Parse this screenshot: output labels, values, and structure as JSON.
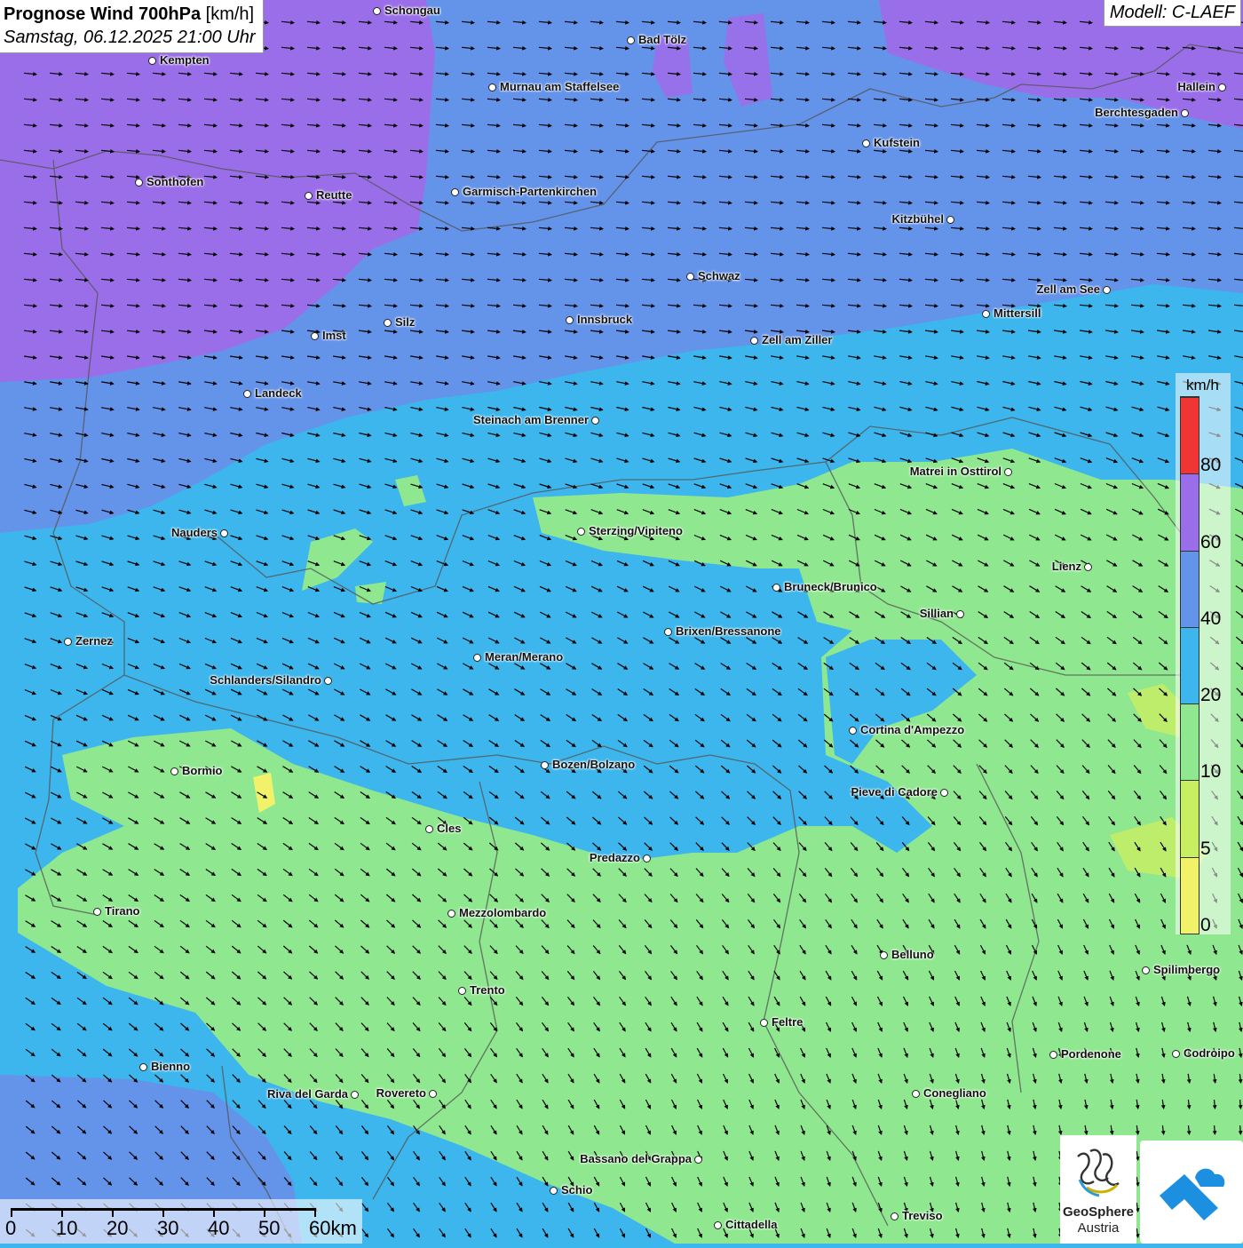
{
  "title": {
    "main": "Prognose Wind 700hPa",
    "unit": "[km/h]",
    "datetime": "Samstag, 06.12.2025 21:00 Uhr"
  },
  "model": "Modell: C-LAEF",
  "legend": {
    "unit": "km/h",
    "levels": [
      "0",
      "5",
      "10",
      "20",
      "40",
      "60",
      "80"
    ],
    "colors": [
      "#f2f26a",
      "#c8ee62",
      "#8fe88f",
      "#3cb6ec",
      "#6493ea",
      "#9b6ee9",
      "#f03535",
      "#6fc8f0"
    ]
  },
  "scalebar": {
    "labels": [
      "0",
      "10",
      "20",
      "30",
      "40",
      "50",
      "60km"
    ]
  },
  "logos": {
    "geosphere_line1": "GeoSphere",
    "geosphere_line2": "Austria"
  },
  "cities": [
    {
      "name": "Schongau"
    },
    {
      "name": "Bad Tölz"
    },
    {
      "name": "Kempten"
    },
    {
      "name": "Murnau am Staffelsee"
    },
    {
      "name": "Hallein"
    },
    {
      "name": "Berchtesgaden"
    },
    {
      "name": "Kufstein"
    },
    {
      "name": "Sonthofen"
    },
    {
      "name": "Reutte"
    },
    {
      "name": "Garmisch-Partenkirchen"
    },
    {
      "name": "Kitzbühel"
    },
    {
      "name": "Schwaz"
    },
    {
      "name": "Zell am See"
    },
    {
      "name": "Mittersill"
    },
    {
      "name": "Imst"
    },
    {
      "name": "Silz"
    },
    {
      "name": "Innsbruck"
    },
    {
      "name": "Zell am Ziller"
    },
    {
      "name": "Landeck"
    },
    {
      "name": "Steinach am Brenner"
    },
    {
      "name": "Matrei in Osttirol"
    },
    {
      "name": "Nauders"
    },
    {
      "name": "Sterzing/Vipiteno"
    },
    {
      "name": "Lienz"
    },
    {
      "name": "Bruneck/Brunico"
    },
    {
      "name": "Sillian"
    },
    {
      "name": "Zernez"
    },
    {
      "name": "Brixen/Bressanone"
    },
    {
      "name": "Meran/Merano"
    },
    {
      "name": "Schlanders/Silandro"
    },
    {
      "name": "Cortina d'Ampezzo"
    },
    {
      "name": "Bormio"
    },
    {
      "name": "Bozen/Bolzano"
    },
    {
      "name": "Pieve di Cadore"
    },
    {
      "name": "Cles"
    },
    {
      "name": "Predazzo"
    },
    {
      "name": "Tirano"
    },
    {
      "name": "Mezzolombardo"
    },
    {
      "name": "Belluno"
    },
    {
      "name": "Spilimbergo"
    },
    {
      "name": "Trento"
    },
    {
      "name": "Feltre"
    },
    {
      "name": "Pordenone"
    },
    {
      "name": "Codroipo"
    },
    {
      "name": "Bienno"
    },
    {
      "name": "Riva del Garda"
    },
    {
      "name": "Rovereto"
    },
    {
      "name": "Conegliano"
    },
    {
      "name": "Bassano del Grappa"
    },
    {
      "name": "Schio"
    },
    {
      "name": "Treviso"
    },
    {
      "name": "Cittadella"
    }
  ]
}
